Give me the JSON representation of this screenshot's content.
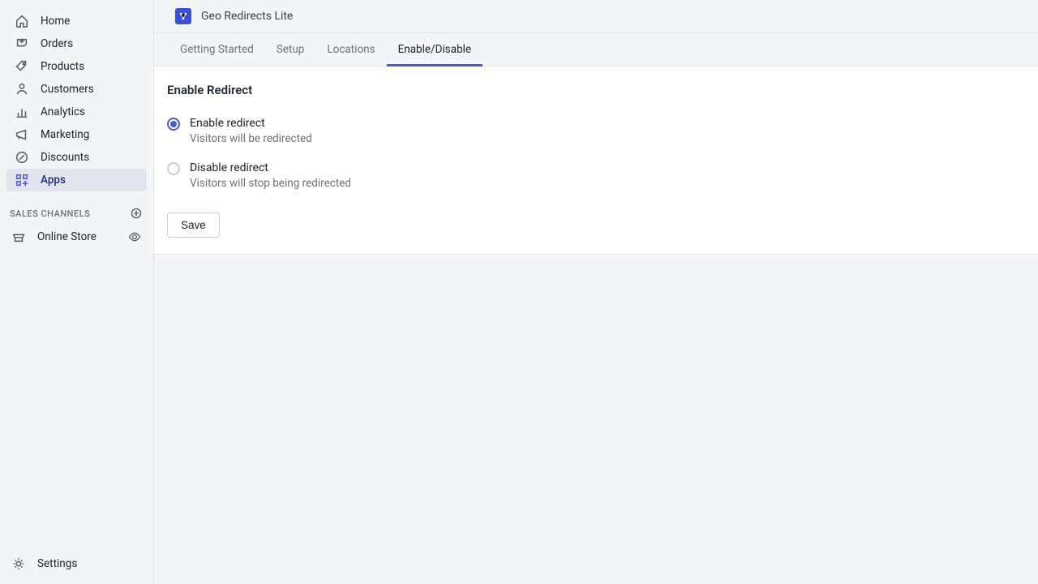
{
  "sidebar": {
    "items": [
      {
        "label": "Home"
      },
      {
        "label": "Orders"
      },
      {
        "label": "Products"
      },
      {
        "label": "Customers"
      },
      {
        "label": "Analytics"
      },
      {
        "label": "Marketing"
      },
      {
        "label": "Discounts"
      },
      {
        "label": "Apps"
      }
    ],
    "sales_channels_label": "SALES CHANNELS",
    "channels": [
      {
        "label": "Online Store"
      }
    ],
    "settings_label": "Settings"
  },
  "header": {
    "app_title": "Geo Redirects Lite"
  },
  "tabs": [
    {
      "label": "Getting Started"
    },
    {
      "label": "Setup"
    },
    {
      "label": "Locations"
    },
    {
      "label": "Enable/Disable"
    }
  ],
  "main": {
    "section_title": "Enable Redirect",
    "options": [
      {
        "label": "Enable redirect",
        "help": "Visitors will be redirected",
        "selected": true
      },
      {
        "label": "Disable redirect",
        "help": "Visitors will stop being redirected",
        "selected": false
      }
    ],
    "save_label": "Save"
  }
}
